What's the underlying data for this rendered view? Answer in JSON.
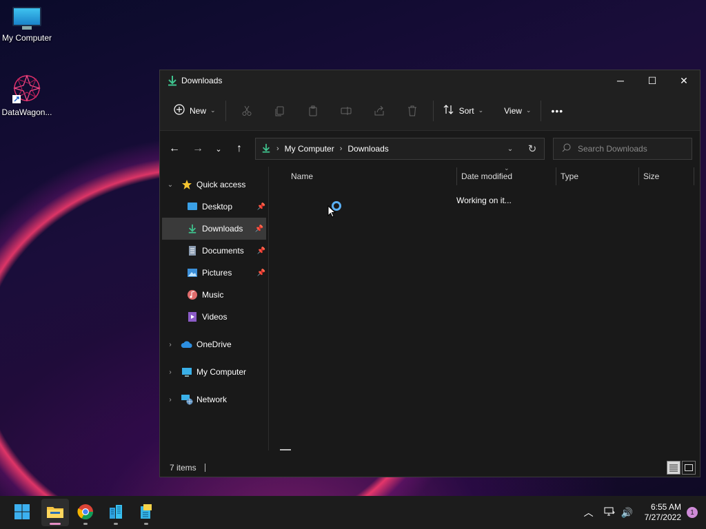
{
  "desktop": {
    "icons": [
      {
        "label": "My Computer"
      },
      {
        "label": "DataWagon..."
      }
    ]
  },
  "window": {
    "title": "Downloads",
    "controls": {
      "minimize": "─",
      "maximize": "☐",
      "close": "✕"
    }
  },
  "commandbar": {
    "new_label": "New",
    "sort_label": "Sort",
    "view_label": "View",
    "more_label": "•••"
  },
  "address": {
    "crumbs": [
      "My Computer",
      "Downloads"
    ]
  },
  "search": {
    "placeholder": "Search Downloads"
  },
  "navpane": {
    "quick_access": "Quick access",
    "items": [
      {
        "label": "Desktop"
      },
      {
        "label": "Downloads"
      },
      {
        "label": "Documents"
      },
      {
        "label": "Pictures"
      },
      {
        "label": "Music"
      },
      {
        "label": "Videos"
      }
    ],
    "onedrive": "OneDrive",
    "computer": "My Computer",
    "network": "Network"
  },
  "columns": {
    "name": "Name",
    "date": "Date modified",
    "type": "Type",
    "size": "Size"
  },
  "content": {
    "status_text": "Working on it..."
  },
  "statusbar": {
    "items_count": "7 items"
  },
  "taskbar": {
    "time": "6:55 AM",
    "date": "7/27/2022",
    "notifications": "1"
  },
  "colors": {
    "accent": "#3fc58f",
    "selection": "#3a3a3a",
    "window_bg": "#191919",
    "taskbar_bg": "#1c1c1c"
  }
}
